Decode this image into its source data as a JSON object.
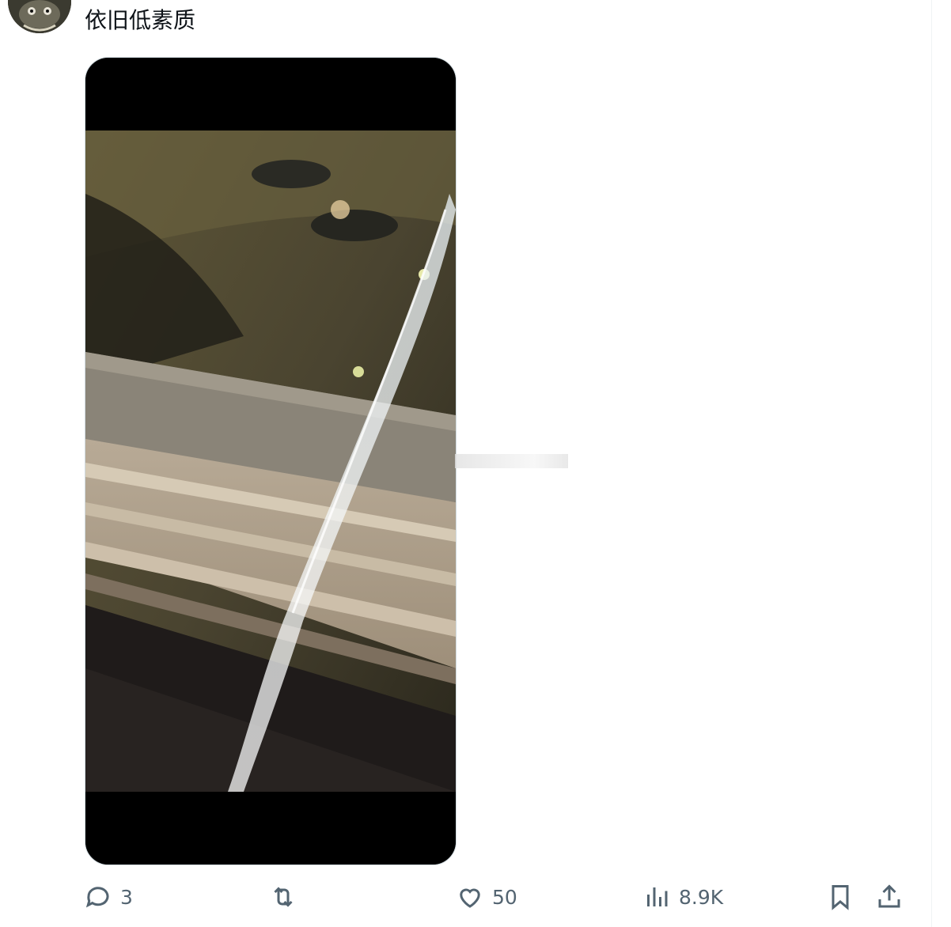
{
  "tweet": {
    "text": "依旧低素质"
  },
  "media": {
    "type": "video"
  },
  "actions": {
    "reply_count": "3",
    "retweet_count": "",
    "like_count": "50",
    "view_count": "8.9K"
  },
  "icons": {
    "reply": "reply-icon",
    "retweet": "retweet-icon",
    "like": "heart-icon",
    "views": "views-icon",
    "bookmark": "bookmark-icon",
    "share": "share-icon"
  }
}
